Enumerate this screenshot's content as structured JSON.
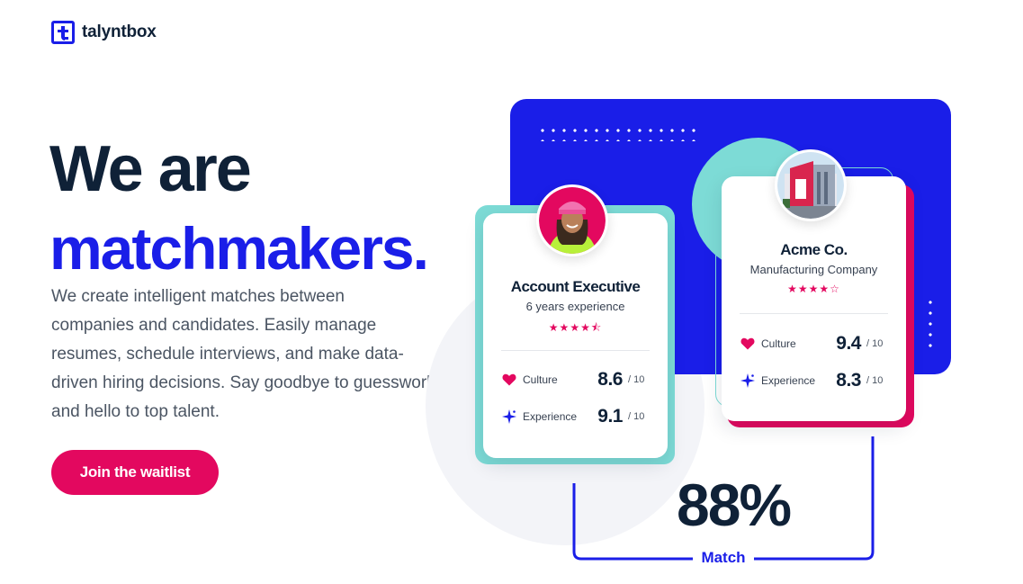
{
  "brand": {
    "name": "talyntbox",
    "color": "#1a1ee8"
  },
  "hero": {
    "line1": "We are",
    "line2": "matchmakers.",
    "description_lines": [
      "We create intelligent matches between",
      "companies and candidates. Easily manage",
      "resumes, schedule interviews, and make data-",
      "driven hiring decisions. Say goodbye to guesswork",
      "and hello to top talent."
    ],
    "cta_label": "Join the waitlist"
  },
  "cards": {
    "candidate": {
      "title": "Account Executive",
      "subtitle": "6 years experience",
      "rating": 4.5,
      "stars_text": "★★★★⯪",
      "metrics": [
        {
          "label": "Culture",
          "score": "8.6",
          "denom": "/ 10",
          "icon": "heart-icon"
        },
        {
          "label": "Experience",
          "score": "9.1",
          "denom": "/ 10",
          "icon": "sparkle-icon"
        }
      ]
    },
    "company": {
      "title": "Acme Co.",
      "subtitle": "Manufacturing Company",
      "rating": 4,
      "stars_text": "★★★★☆",
      "metrics": [
        {
          "label": "Culture",
          "score": "9.4",
          "denom": "/ 10",
          "icon": "heart-icon"
        },
        {
          "label": "Experience",
          "score": "8.3",
          "denom": "/ 10",
          "icon": "sparkle-icon"
        }
      ]
    }
  },
  "match": {
    "percent": "88%",
    "label": "Match"
  },
  "colors": {
    "accent_blue": "#1a1ee8",
    "accent_pink": "#e3085f",
    "teal": "#7ddbd6",
    "dark_text": "#0f2137"
  }
}
